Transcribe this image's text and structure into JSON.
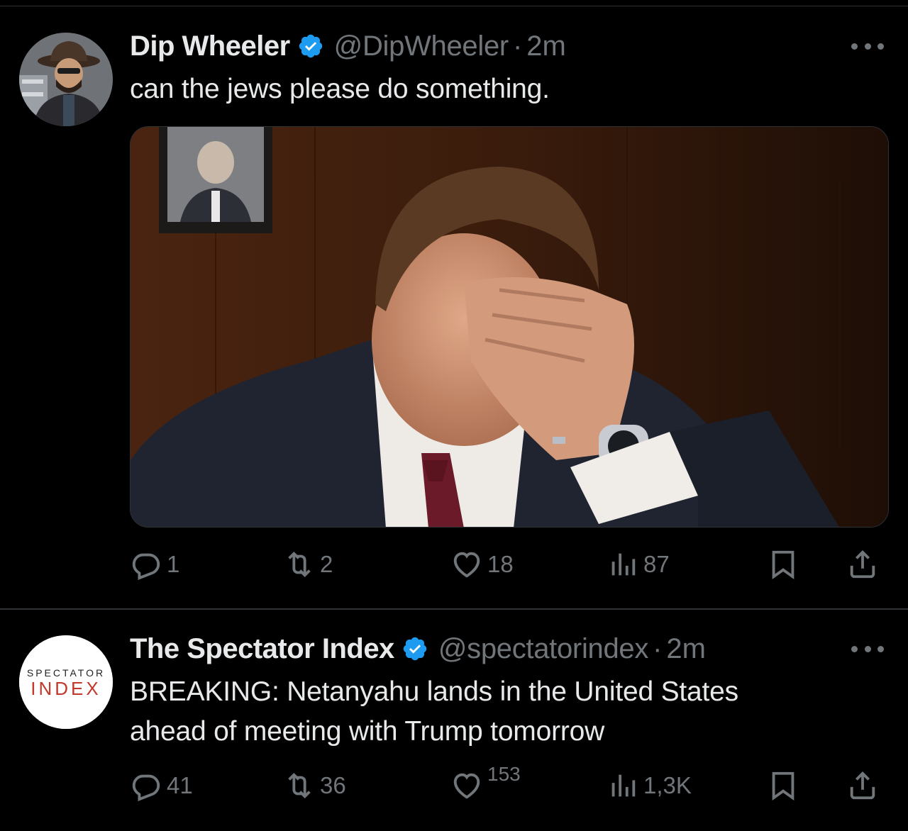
{
  "colors": {
    "background": "#000000",
    "text_primary": "#e7e9ea",
    "text_secondary": "#71767b",
    "verified_badge": "#1d9bf0",
    "divider": "#2f3336"
  },
  "tweets": [
    {
      "display_name": "Dip Wheeler",
      "verified": true,
      "handle": "@DipWheeler",
      "separator": "·",
      "time": "2m",
      "text": "can the jews please do something.",
      "media": "photo-man-facepalm-office",
      "actions": {
        "replies": "1",
        "reposts": "2",
        "likes": "18",
        "views": "87"
      }
    },
    {
      "display_name": "The Spectator Index",
      "verified": true,
      "handle": "@spectatorindex",
      "separator": "·",
      "time": "2m",
      "text_line1": "BREAKING: Netanyahu lands in the United States",
      "text_line2": "ahead of meeting with Trump tomorrow",
      "avatar_logo": {
        "line1": "SPECTATOR",
        "line2": "INDEX"
      },
      "actions": {
        "replies": "41",
        "reposts": "36",
        "likes": "153",
        "views": "1,3K"
      }
    }
  ],
  "icons": {
    "verified": "verified-badge-icon",
    "more": "more-dots-icon",
    "reply": "reply-bubble-icon",
    "repost": "repost-arrows-icon",
    "like": "heart-icon",
    "views": "views-bars-icon",
    "bookmark": "bookmark-icon",
    "share": "share-upload-icon"
  }
}
